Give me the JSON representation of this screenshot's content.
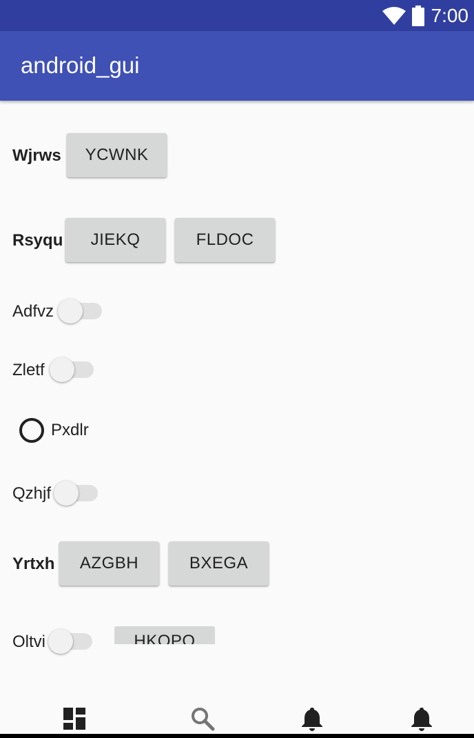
{
  "status_bar": {
    "time": "7:00",
    "wifi_icon": "wifi-icon",
    "battery_icon": "battery-icon"
  },
  "app_bar": {
    "title": "android_gui"
  },
  "rows": {
    "row1": {
      "label": "Wjrws",
      "button": "YCWNK"
    },
    "row2": {
      "label": "Rsyqu",
      "button1": "JIEKQ",
      "button2": "FLDOC"
    },
    "row3": {
      "label": "Adfvz",
      "switch_on": false
    },
    "row4": {
      "label": "Zletf",
      "switch_on": false
    },
    "row5": {
      "label": "Pxdlr",
      "radio_checked": false
    },
    "row6": {
      "label": "Qzhjf",
      "switch_on": false
    },
    "row7": {
      "label": "Yrtxh",
      "button1": "AZGBH",
      "button2": "BXEGA"
    },
    "row8": {
      "label": "Oltvi",
      "switch_on": false,
      "button": "HKQPO"
    }
  },
  "bottom_nav": {
    "items": [
      {
        "icon": "dashboard-icon"
      },
      {
        "icon": "search-icon"
      },
      {
        "icon": "notifications-icon"
      },
      {
        "icon": "notifications-icon"
      }
    ],
    "active_color": "#212121",
    "inactive_color": "#757575"
  },
  "colors": {
    "status_bar": "#303f9f",
    "app_bar": "#3f51b5",
    "background": "#fafafa",
    "button": "#d6d7d7"
  }
}
